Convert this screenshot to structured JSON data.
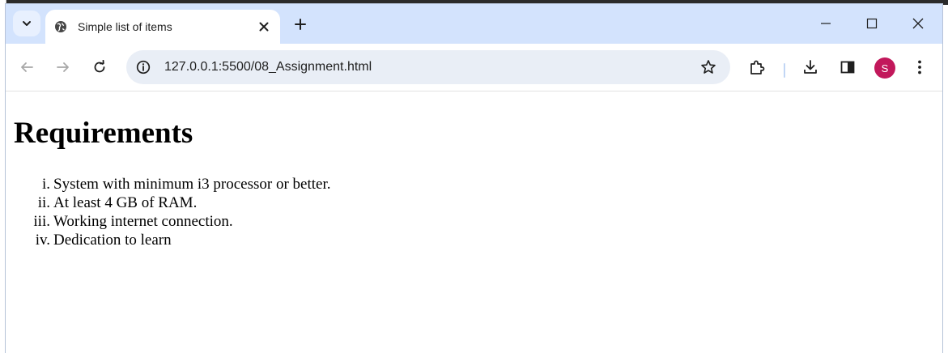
{
  "browser": {
    "tab": {
      "title": "Simple list of items"
    },
    "address_bar": {
      "url": "127.0.0.1:5500/08_Assignment.html"
    },
    "profile": {
      "initial": "S",
      "color": "#c2185b"
    },
    "accent_color": "#d3e3fd"
  },
  "page": {
    "heading": "Requirements",
    "list_items": [
      {
        "marker": "i.",
        "text": "System with minimum i3 processor or better."
      },
      {
        "marker": "ii.",
        "text": "At least 4 GB of RAM."
      },
      {
        "marker": "iii.",
        "text": "Working internet connection."
      },
      {
        "marker": "iv.",
        "text": "Dedication to learn"
      }
    ]
  },
  "icons": {
    "tab_search": "chevron-down-icon",
    "tab_favicon": "globe-icon",
    "tab_close": "close-icon",
    "new_tab": "plus-icon",
    "minimize": "minimize-icon",
    "maximize": "maximize-icon",
    "close_window": "close-icon",
    "back": "arrow-left-icon",
    "forward": "arrow-right-icon",
    "reload": "reload-icon",
    "site_info": "info-icon",
    "bookmark": "star-icon",
    "extensions": "puzzle-icon",
    "downloads": "download-icon",
    "side_panel": "side-panel-icon",
    "menu": "more-vert-icon"
  }
}
